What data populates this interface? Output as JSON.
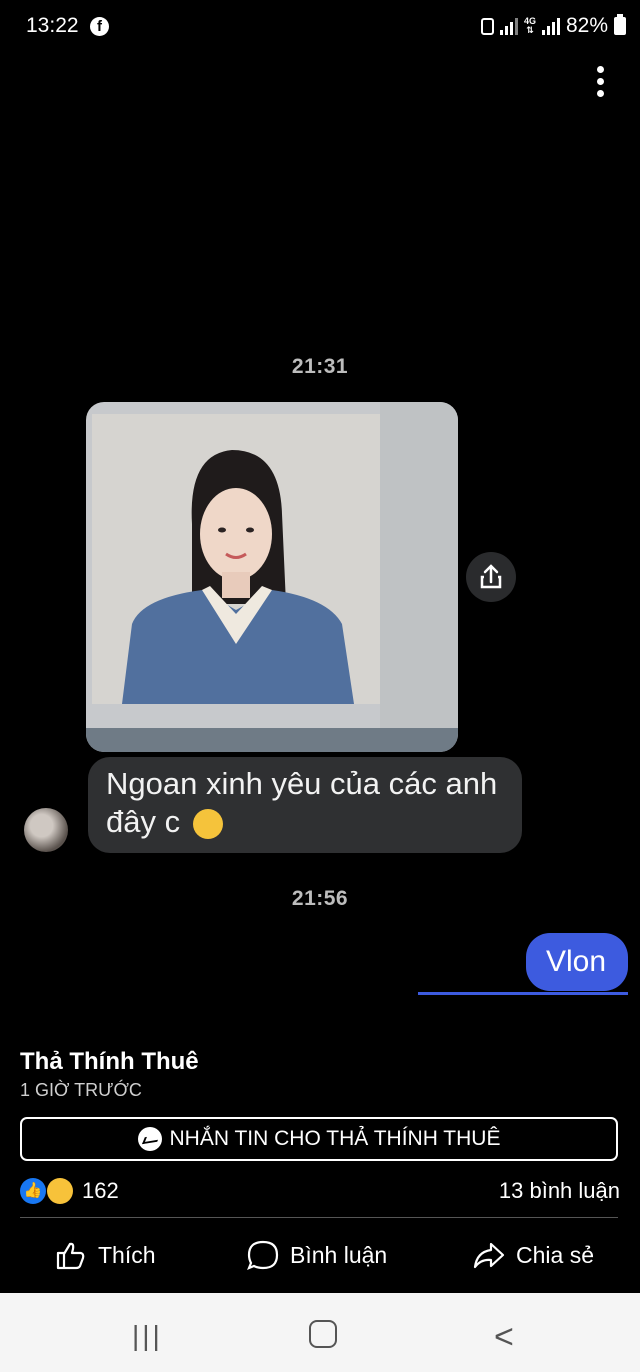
{
  "status_bar": {
    "time": "13:22",
    "network": "4G",
    "battery": "82%"
  },
  "chat": {
    "timestamp_1": "21:31",
    "received_message_lines": [
      "Ngoan xinh yêu của các anh",
      "đây c"
    ],
    "timestamp_2": "21:56",
    "sent_message": "Vlon"
  },
  "post": {
    "page_name": "Thả Thính Thuê",
    "time_ago": "1 GIỜ TRƯỚC",
    "message_button": "NHẮN TIN CHO THẢ THÍNH THUÊ",
    "reaction_count": "162",
    "comment_count": "13 bình luận",
    "actions": {
      "like": "Thích",
      "comment": "Bình luận",
      "share": "Chia sẻ"
    }
  },
  "nav": {
    "recents": "|||",
    "back": "<"
  }
}
